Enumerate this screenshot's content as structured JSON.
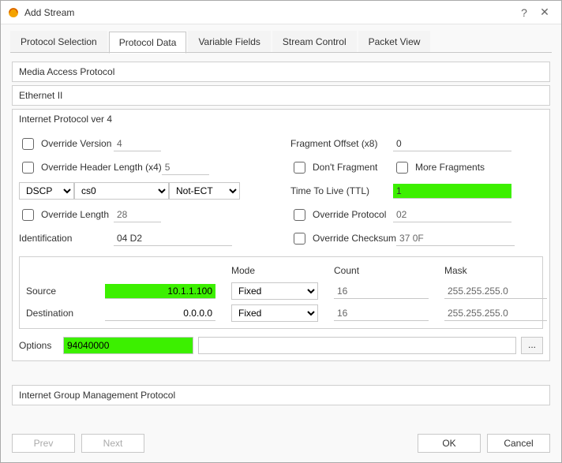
{
  "window": {
    "title": "Add Stream"
  },
  "tabs": [
    "Protocol Selection",
    "Protocol Data",
    "Variable Fields",
    "Stream Control",
    "Packet View"
  ],
  "activeTab": 1,
  "sections": {
    "mac": "Media Access Protocol",
    "eth": "Ethernet II",
    "ip": "Internet Protocol ver 4",
    "igmp": "Internet Group Management Protocol"
  },
  "ipv4": {
    "override_version_label": "Override Version",
    "version": "4",
    "override_hdrlen_label": "Override Header Length (x4)",
    "hdrlen": "5",
    "dscp_label": "DSCP",
    "dscp_code": "cs0",
    "dscp_ecn": "Not-ECT",
    "override_len_label": "Override Length",
    "length": "28",
    "identification_label": "Identification",
    "identification": "04 D2",
    "frag_offset_label": "Fragment Offset (x8)",
    "frag_offset": "0",
    "dont_fragment_label": "Don't Fragment",
    "more_fragments_label": "More Fragments",
    "ttl_label": "Time To Live (TTL)",
    "ttl": "1",
    "override_proto_label": "Override Protocol",
    "protocol": "02",
    "override_cksum_label": "Override Checksum",
    "checksum": "37 0F",
    "addr_headers": {
      "mode": "Mode",
      "count": "Count",
      "mask": "Mask",
      "source": "Source",
      "destination": "Destination"
    },
    "src_ip": "10.1.1.100",
    "src_mode": "Fixed",
    "src_count": "16",
    "src_mask": "255.255.255.0",
    "dst_ip": "0.0.0.0",
    "dst_mode": "Fixed",
    "dst_count": "16",
    "dst_mask": "255.255.255.0",
    "options_label": "Options",
    "options": "94040000"
  },
  "footer": {
    "prev": "Prev",
    "next": "Next",
    "ok": "OK",
    "cancel": "Cancel"
  }
}
